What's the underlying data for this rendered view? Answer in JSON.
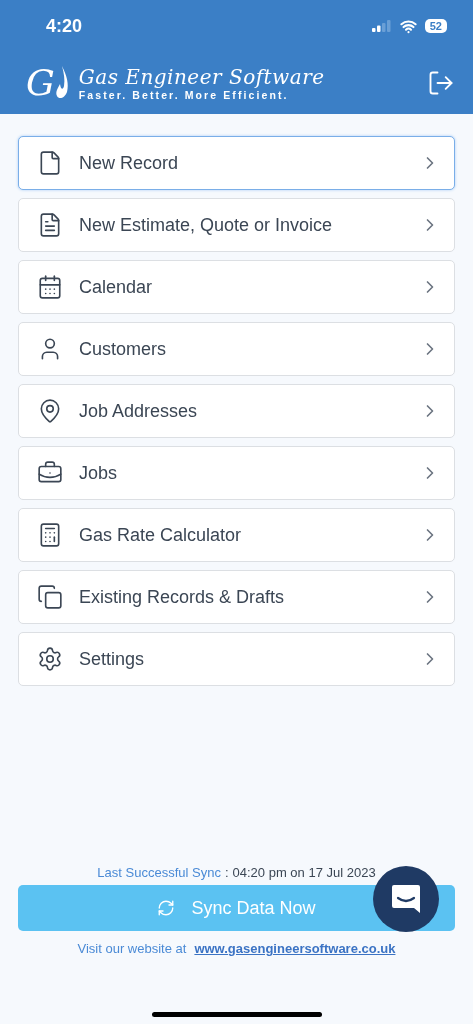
{
  "status_bar": {
    "time": "4:20",
    "battery": "52"
  },
  "header": {
    "logo_letter": "G",
    "title": "Gas Engineer Software",
    "tagline": "Faster. Better. More Efficient."
  },
  "menu": [
    {
      "label": "New Record",
      "selected": true
    },
    {
      "label": "New Estimate, Quote or Invoice",
      "selected": false
    },
    {
      "label": "Calendar",
      "selected": false
    },
    {
      "label": "Customers",
      "selected": false
    },
    {
      "label": "Job Addresses",
      "selected": false
    },
    {
      "label": "Jobs",
      "selected": false
    },
    {
      "label": "Gas Rate Calculator",
      "selected": false
    },
    {
      "label": "Existing Records & Drafts",
      "selected": false
    },
    {
      "label": "Settings",
      "selected": false
    }
  ],
  "footer": {
    "sync_label": "Last Successful Sync",
    "sync_separator": ":",
    "sync_time": "04:20 pm on 17 Jul 2023",
    "sync_button": "Sync Data Now",
    "website_prefix": "Visit our website at",
    "website_link": "www.gasengineersoftware.co.uk"
  }
}
